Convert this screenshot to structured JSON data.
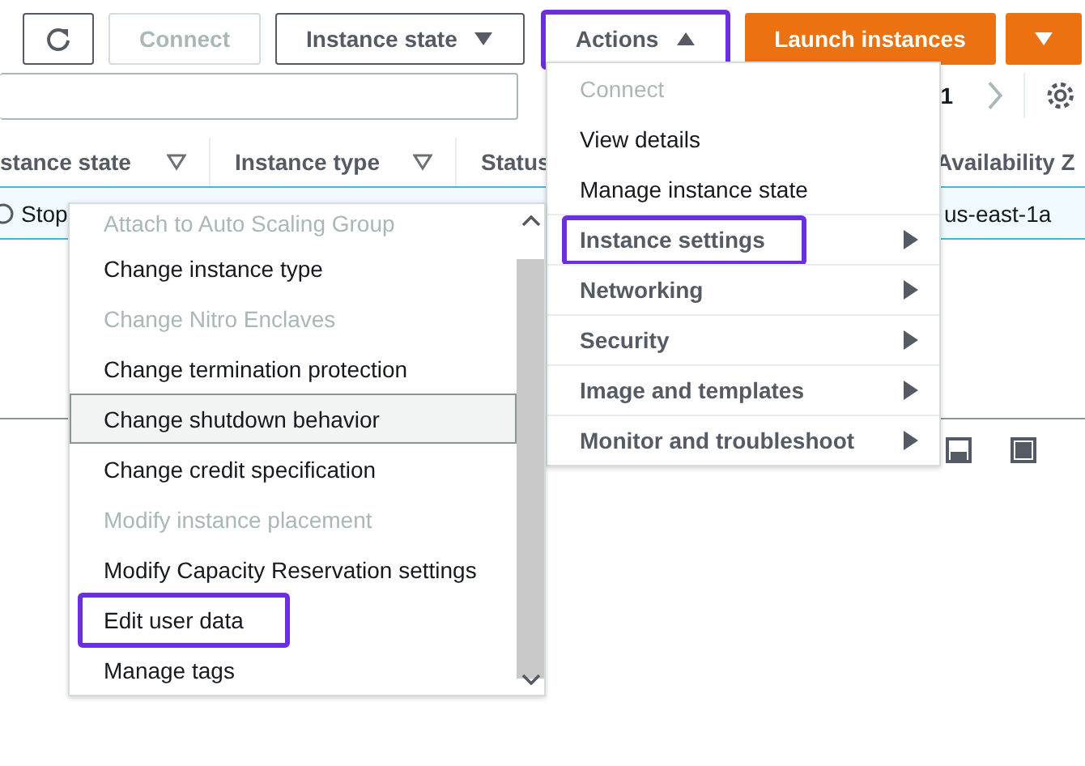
{
  "toolbar": {
    "connect": {
      "label": "Connect",
      "disabled": true
    },
    "instance_state": {
      "label": "Instance state",
      "expanded": false
    },
    "actions": {
      "label": "Actions",
      "expanded": true,
      "highlighted": true
    },
    "launch": {
      "label": "Launch instances"
    }
  },
  "pagination": {
    "page": "1"
  },
  "table": {
    "columns": [
      {
        "label": "stance state",
        "filter": true
      },
      {
        "label": "Instance type",
        "filter": true
      },
      {
        "label": "Status",
        "filter": false
      },
      {
        "label": "Availability Z",
        "filter": false
      }
    ],
    "rows": [
      {
        "instance_state": "Stop",
        "availability_zone": "us-east-1a",
        "selected": true
      }
    ]
  },
  "actions_menu": {
    "items": [
      {
        "label": "Connect",
        "kind": "item",
        "disabled": true,
        "highlighted": false
      },
      {
        "label": "View details",
        "kind": "item",
        "disabled": false,
        "highlighted": false
      },
      {
        "label": "Manage instance state",
        "kind": "item",
        "disabled": false,
        "highlighted": false
      },
      {
        "label": "Instance settings",
        "kind": "submenu",
        "disabled": false,
        "highlighted": true
      },
      {
        "label": "Networking",
        "kind": "submenu",
        "disabled": false,
        "highlighted": false
      },
      {
        "label": "Security",
        "kind": "submenu",
        "disabled": false,
        "highlighted": false
      },
      {
        "label": "Image and templates",
        "kind": "submenu",
        "disabled": false,
        "highlighted": false
      },
      {
        "label": "Monitor and troubleshoot",
        "kind": "submenu",
        "disabled": false,
        "highlighted": false
      }
    ]
  },
  "instance_settings_menu": {
    "items": [
      {
        "label": "Attach to Auto Scaling Group",
        "disabled": true,
        "hovered": false,
        "highlighted": false
      },
      {
        "label": "Change instance type",
        "disabled": false,
        "hovered": false,
        "highlighted": false
      },
      {
        "label": "Change Nitro Enclaves",
        "disabled": true,
        "hovered": false,
        "highlighted": false
      },
      {
        "label": "Change termination protection",
        "disabled": false,
        "hovered": false,
        "highlighted": false
      },
      {
        "label": "Change shutdown behavior",
        "disabled": false,
        "hovered": true,
        "highlighted": false
      },
      {
        "label": "Change credit specification",
        "disabled": false,
        "hovered": false,
        "highlighted": false
      },
      {
        "label": "Modify instance placement",
        "disabled": true,
        "hovered": false,
        "highlighted": false
      },
      {
        "label": "Modify Capacity Reservation settings",
        "disabled": false,
        "hovered": false,
        "highlighted": false
      },
      {
        "label": "Edit user data",
        "disabled": false,
        "hovered": false,
        "highlighted": true
      },
      {
        "label": "Manage tags",
        "disabled": false,
        "hovered": false,
        "highlighted": false
      }
    ]
  }
}
